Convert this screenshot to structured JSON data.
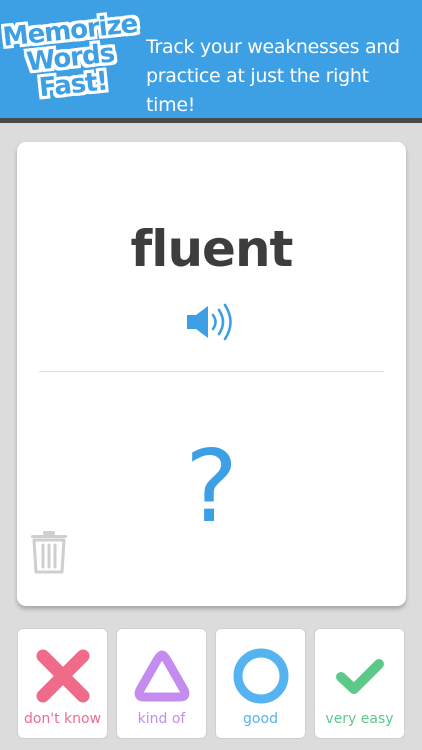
{
  "banner": {
    "logo_lines": [
      "Memorize",
      "Words",
      "Fast!"
    ],
    "tagline_lines": [
      "Track your weaknesses and",
      "practice at just the right time!"
    ],
    "colors": {
      "background": "#3ea0e4",
      "text": "#ffffff"
    }
  },
  "card": {
    "word": "fluent",
    "answer_placeholder": "?",
    "icons": {
      "audio": "speaker-icon",
      "delete": "trash-icon"
    }
  },
  "answers": [
    {
      "label": "don't know",
      "icon": "x-icon",
      "color": "#f06b8a"
    },
    {
      "label": "kind of",
      "icon": "triangle-icon",
      "color": "#c58cf0"
    },
    {
      "label": "good",
      "icon": "circle-icon",
      "color": "#54b3f0"
    },
    {
      "label": "very easy",
      "icon": "checkmark-icon",
      "color": "#5cc98a"
    }
  ]
}
